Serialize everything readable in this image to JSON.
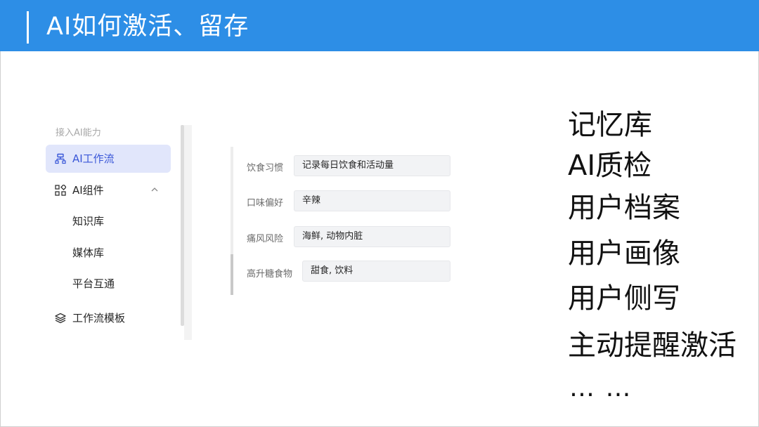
{
  "header": {
    "title": "AI如何激活、留存"
  },
  "sidebar": {
    "section_title": "接入AI能力",
    "items": [
      {
        "label": "AI工作流",
        "icon": "workflow-icon",
        "active": true
      },
      {
        "label": "AI组件",
        "icon": "component-icon",
        "expanded": true
      },
      {
        "label": "知识库",
        "sub": true
      },
      {
        "label": "媒体库",
        "sub": true
      },
      {
        "label": "平台互通",
        "sub": true
      },
      {
        "label": "工作流模板",
        "icon": "layers-icon"
      }
    ]
  },
  "form": {
    "fields": [
      {
        "label": "饮食习惯",
        "value": "记录每日饮食和活动量"
      },
      {
        "label": "口味偏好",
        "value": "辛辣"
      },
      {
        "label": "痛风风险",
        "value": "海鲜, 动物内脏"
      },
      {
        "label": "高升糖食物",
        "value": "甜食, 饮料"
      }
    ]
  },
  "features": [
    "记忆库",
    "AI质检",
    "用户档案",
    "用户画像",
    "用户侧写",
    "主动提醒激活"
  ],
  "features_more": "…  …",
  "colors": {
    "header_bg": "#2d8ee6",
    "active_bg": "#e1e6fb",
    "active_text": "#3a57d8"
  }
}
